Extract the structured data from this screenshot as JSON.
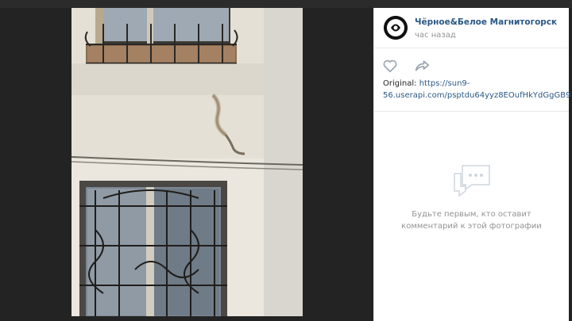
{
  "post": {
    "author": "Чёрное&Белое Магнитогорск",
    "time": "час назад",
    "original_label": "Original:",
    "original_link_line1": "https://sun9-",
    "original_link_line2": "56.userapi.com/psptdu64yyz8EOufHkYdGgGB9.."
  },
  "comments": {
    "empty_line1": "Будьте первым, кто оставит",
    "empty_line2": "комментарий к этой фотографии"
  },
  "icons": {
    "like": "heart-icon",
    "share": "share-arrow-icon",
    "empty": "comments-bubble-icon"
  },
  "colors": {
    "link": "#2a5885",
    "muted": "#939393",
    "viewer_bg": "#232323"
  }
}
